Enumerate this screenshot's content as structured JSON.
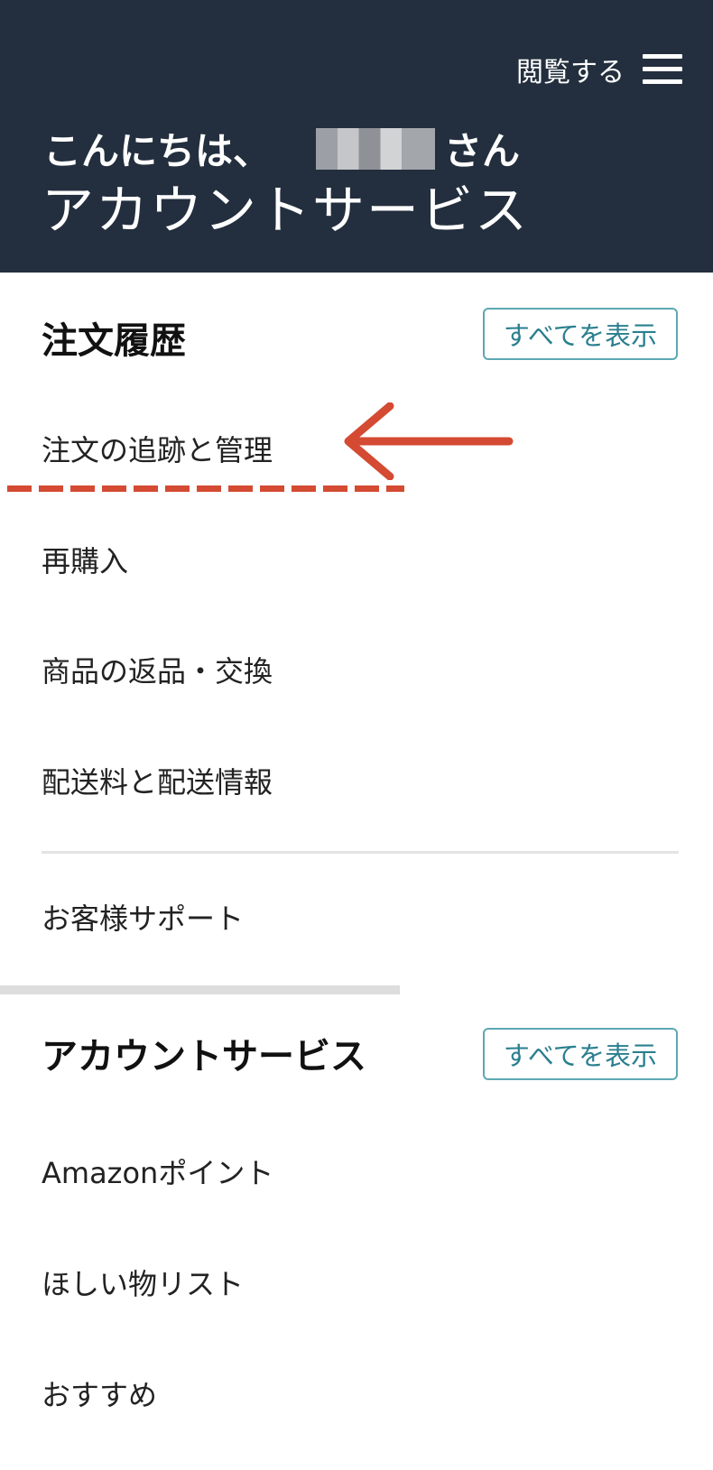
{
  "header": {
    "browse_label": "閲覧する",
    "greeting_prefix": "こんにちは、",
    "greeting_suffix": "さん",
    "title": "アカウントサービス"
  },
  "order_history": {
    "heading": "注文履歴",
    "show_all_label": "すべてを表示",
    "items": [
      {
        "label": "注文の追跡と管理"
      },
      {
        "label": "再購入"
      },
      {
        "label": "商品の返品・交換"
      },
      {
        "label": "配送料と配送情報"
      }
    ],
    "support_label": "お客様サポート"
  },
  "account_services": {
    "heading": "アカウントサービス",
    "show_all_label": "すべてを表示",
    "items": [
      {
        "label": "Amazonポイント"
      },
      {
        "label": "ほしい物リスト"
      },
      {
        "label": "おすすめ"
      }
    ]
  },
  "colors": {
    "header_bg": "#232f3e",
    "button_border": "#5da8b4",
    "annotation": "#d44a32"
  },
  "icons": [
    "hamburger-menu-icon",
    "annotation-arrow-icon"
  ]
}
